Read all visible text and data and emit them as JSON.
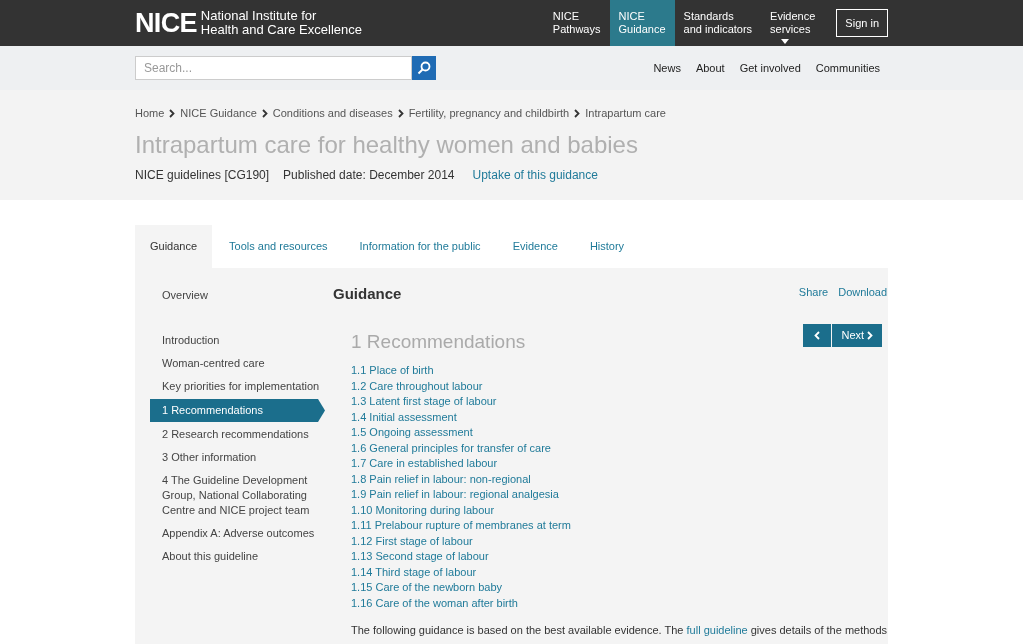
{
  "header": {
    "logo": "NICE",
    "logo_subtitle": [
      "National Institute for",
      "Health and Care Excellence"
    ],
    "nav": [
      {
        "label": [
          "NICE",
          "Pathways"
        ],
        "selected": false,
        "dropdown": false
      },
      {
        "label": [
          "NICE",
          "Guidance"
        ],
        "selected": true,
        "dropdown": false
      },
      {
        "label": [
          "Standards",
          "and indicators"
        ],
        "selected": false,
        "dropdown": false
      },
      {
        "label": [
          "Evidence",
          "services"
        ],
        "selected": false,
        "dropdown": true
      }
    ],
    "sign_in": "Sign in"
  },
  "search": {
    "placeholder": "Search..."
  },
  "secondary_nav": [
    "News",
    "About",
    "Get involved",
    "Communities"
  ],
  "breadcrumbs": [
    "Home",
    "NICE Guidance",
    "Conditions and diseases",
    "Fertility, pregnancy and childbirth",
    "Intrapartum care"
  ],
  "title": "Intrapartum care for healthy women and babies",
  "meta": {
    "reference": "NICE guidelines [CG190]",
    "published": "Published date: December 2014",
    "link": "Uptake of this guidance"
  },
  "tabs": [
    {
      "label": "Guidance",
      "selected": true
    },
    {
      "label": "Tools and resources",
      "selected": false
    },
    {
      "label": "Information for the public",
      "selected": false
    },
    {
      "label": "Evidence",
      "selected": false
    },
    {
      "label": "History",
      "selected": false
    }
  ],
  "sidebar": {
    "items": [
      {
        "label": "Overview",
        "selected": false
      },
      {
        "label": "Introduction",
        "selected": false
      },
      {
        "label": "Woman-centred care",
        "selected": false
      },
      {
        "label": "Key priorities for implementation",
        "selected": false
      },
      {
        "label": "1 Recommendations",
        "selected": true
      },
      {
        "label": "2 Research recommendations",
        "selected": false
      },
      {
        "label": "3 Other information",
        "selected": false
      },
      {
        "label": "4 The Guideline Development Group, National Collaborating Centre and NICE project team",
        "selected": false
      },
      {
        "label": "Appendix A: Adverse outcomes",
        "selected": false
      },
      {
        "label": "About this guideline",
        "selected": false
      }
    ]
  },
  "content": {
    "heading": "Guidance",
    "actions": [
      "Share",
      "Download"
    ],
    "next": "Next",
    "section_title": "1 Recommendations",
    "links": [
      "1.1 Place of birth",
      "1.2 Care throughout labour",
      "1.3 Latent first stage of labour",
      "1.4 Initial assessment",
      "1.5 Ongoing assessment",
      "1.6 General principles for transfer of care",
      "1.7 Care in established labour",
      "1.8 Pain relief in labour: non-regional",
      "1.9 Pain relief in labour: regional analgesia",
      "1.10 Monitoring during labour",
      "1.11 Prelabour rupture of membranes at term",
      "1.12 First stage of labour",
      "1.13 Second stage of labour",
      "1.14 Third stage of labour",
      "1.15 Care of the newborn baby",
      "1.16 Care of the woman after birth"
    ],
    "paragraph": {
      "before": "The following guidance is based on the best available evidence. The ",
      "link": "full guideline",
      "after": " gives details of the methods"
    }
  }
}
